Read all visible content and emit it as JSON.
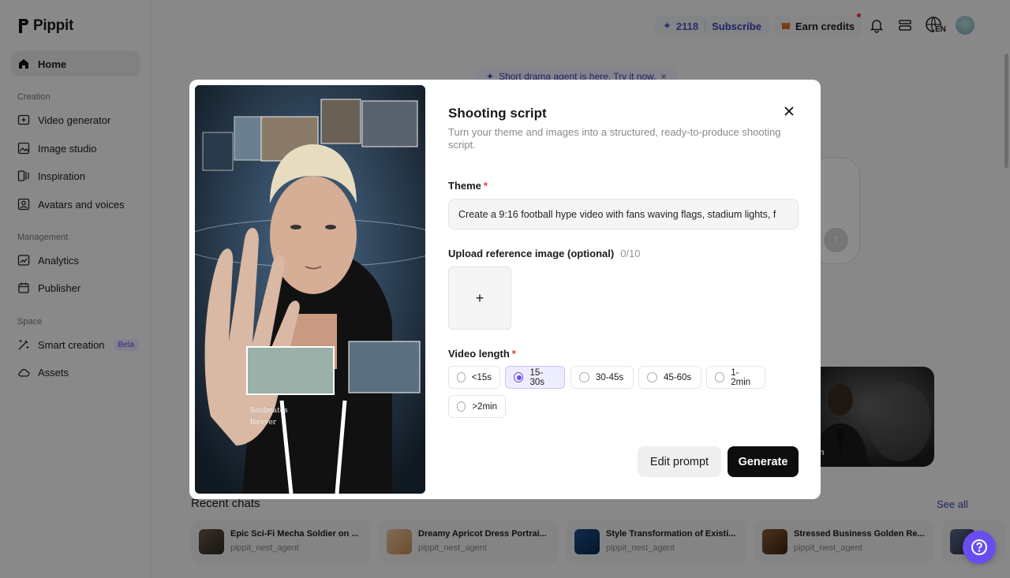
{
  "app": {
    "name": "Pippit"
  },
  "sidebar": {
    "home": "Home",
    "section_creation": "Creation",
    "creation_items": [
      "Video generator",
      "Image studio",
      "Inspiration",
      "Avatars and voices"
    ],
    "section_management": "Management",
    "management_items": [
      "Analytics",
      "Publisher"
    ],
    "section_space": "Space",
    "smart_creation": "Smart creation",
    "beta": "Beta",
    "assets": "Assets"
  },
  "topbar": {
    "credits": "2118",
    "subscribe": "Subscribe",
    "earn_credits": "Earn credits",
    "lang": "EN"
  },
  "background": {
    "banner": "Short drama agent is here. Try it now.",
    "card_text": "n",
    "recent_chats": "Recent chats",
    "see_all": "See all",
    "chats": [
      {
        "title": "Epic Sci-Fi Mecha Soldier on ...",
        "sub": "pippit_nest_agent"
      },
      {
        "title": "Dreamy Apricot Dress Portrai...",
        "sub": "pippit_nest_agent"
      },
      {
        "title": "Style Transformation of Existi...",
        "sub": "pippit_nest_agent"
      },
      {
        "title": "Stressed Business Golden Re...",
        "sub": "pippit_nest_agent"
      }
    ]
  },
  "modal": {
    "title": "Shooting script",
    "description": "Turn your theme and images into a structured, ready-to-produce shooting script.",
    "theme_label": "Theme",
    "required_mark": "*",
    "theme_value": "Create a 9:16 football hype video with fans waving flags, stadium lights, f",
    "upload_label": "Upload reference image (optional)",
    "upload_count": "0/10",
    "upload_plus": "+",
    "length_label": "Video length",
    "length_options": [
      "<15s",
      "15-30s",
      "30-45s",
      "45-60s",
      "1-2min",
      ">2min"
    ],
    "selected_length": "15-30s",
    "edit_prompt": "Edit prompt",
    "generate": "Generate"
  },
  "colors": {
    "accent": "#6a4df0",
    "link": "#3b41b8",
    "required": "#e53935"
  }
}
